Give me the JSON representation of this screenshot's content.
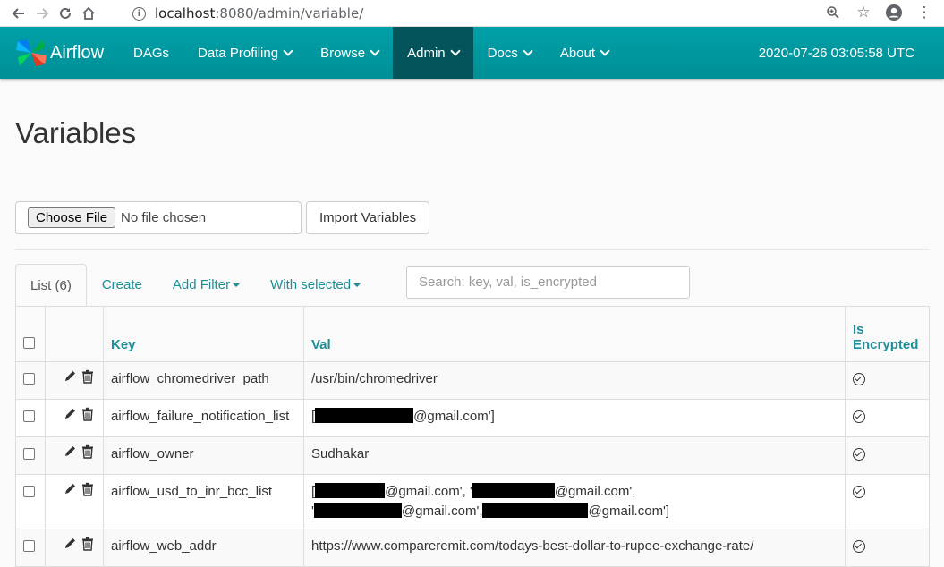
{
  "browser": {
    "url_host": "localhost",
    "url_path": ":8080/admin/variable/"
  },
  "navbar": {
    "brand": "Airflow",
    "items": [
      {
        "label": "DAGs"
      },
      {
        "label": "Data Profiling"
      },
      {
        "label": "Browse"
      },
      {
        "label": "Admin"
      },
      {
        "label": "Docs"
      },
      {
        "label": "About"
      }
    ],
    "clock": "2020-07-26 03:05:58 UTC"
  },
  "page": {
    "title": "Variables",
    "choose_file": "Choose File",
    "no_file": "No file chosen",
    "import_button": "Import Variables"
  },
  "tabs": {
    "list": "List (6)",
    "create": "Create",
    "add_filter": "Add Filter",
    "with_selected": "With selected",
    "search_placeholder": "Search: key, val, is_encrypted"
  },
  "table": {
    "headers": {
      "key": "Key",
      "val": "Val",
      "encrypted_line1": "Is",
      "encrypted_line2": "Encrypted"
    },
    "rows": [
      {
        "key": "airflow_chromedriver_path",
        "val": "/usr/bin/chromedriver"
      },
      {
        "key": "airflow_failure_notification_list",
        "val_suffix": "@gmail.com']"
      },
      {
        "key": "airflow_owner",
        "val": "Sudhakar"
      },
      {
        "key": "airflow_usd_to_inr_bcc_list",
        "val_parts": [
          "@gmail.com', '",
          "@gmail.com',",
          "@gmail.com',",
          "@gmail.com']"
        ]
      },
      {
        "key": "airflow_web_addr",
        "val": "https://www.compareremit.com/todays-best-dollar-to-rupee-exchange-rate/"
      }
    ]
  }
}
